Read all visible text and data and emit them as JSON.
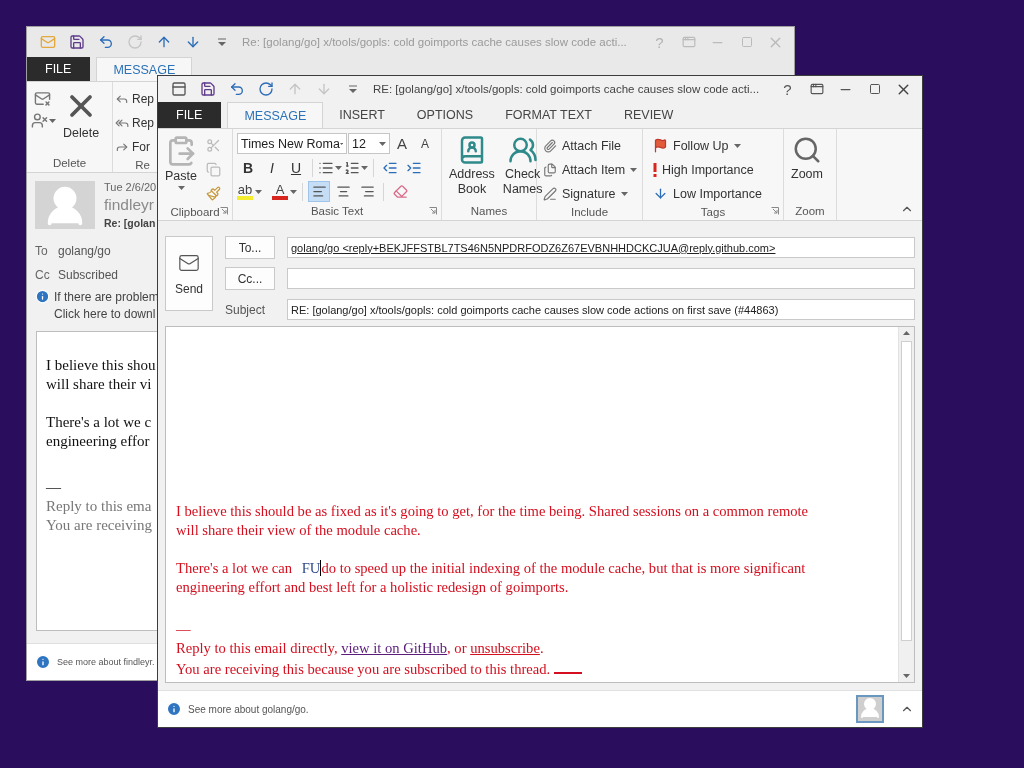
{
  "back_window": {
    "title": "Re: [golang/go] x/tools/gopls: cold goimports cache causes slow code acti...",
    "help": "?",
    "quick_access": [
      {
        "kind": "envelope",
        "disabled": false
      },
      {
        "kind": "save",
        "disabled": false
      },
      {
        "kind": "undo",
        "disabled": false
      },
      {
        "kind": "redo",
        "disabled": true
      },
      {
        "kind": "up",
        "disabled": false
      },
      {
        "kind": "down",
        "disabled": false
      }
    ],
    "tabs": [
      {
        "kind": "file",
        "label": "FILE",
        "selected": false
      },
      {
        "kind": "tab",
        "label": "MESSAGE",
        "selected": true
      }
    ],
    "delete_group": {
      "label": "Delete",
      "button": "Delete"
    },
    "respond_group": {
      "label": "Re",
      "items": [
        {
          "kind": "reply",
          "label": "Rep"
        },
        {
          "kind": "reply_all",
          "label": "Rep"
        },
        {
          "kind": "forward",
          "label": "For"
        }
      ]
    },
    "header": {
      "date": "Tue 2/6/20",
      "sender": "findleyr",
      "subject": "Re: [golan",
      "to_label": "To",
      "to": "golang/go",
      "cc_label": "Cc",
      "cc": "Subscribed",
      "info": [
        "If there are problem",
        "Click here to downl"
      ]
    },
    "body": [
      {
        "kind": "text",
        "lines": [
          "I believe this shou",
          "will share their vi"
        ]
      },
      {
        "kind": "text",
        "lines": [
          "There's a lot we c",
          "engineering effor"
        ]
      },
      {
        "kind": "separator",
        "lines": [
          "—"
        ]
      },
      {
        "kind": "note",
        "lines": [
          "Reply to this ema",
          "You are receiving"
        ]
      }
    ],
    "footer": "See more about findleyr."
  },
  "front_window": {
    "title": "RE: [golang/go] x/tools/gopls: cold goimports cache causes slow code acti...",
    "help": "?",
    "quick_access": [
      {
        "kind": "compose",
        "disabled": false
      },
      {
        "kind": "save",
        "disabled": false
      },
      {
        "kind": "undo",
        "disabled": false
      },
      {
        "kind": "redo",
        "disabled": false
      },
      {
        "kind": "up",
        "disabled": true
      },
      {
        "kind": "down",
        "disabled": true
      }
    ],
    "tabs": [
      {
        "kind": "file",
        "label": "FILE",
        "selected": false
      },
      {
        "kind": "tab",
        "label": "MESSAGE",
        "selected": true
      },
      {
        "kind": "tab",
        "label": "INSERT",
        "selected": false
      },
      {
        "kind": "tab",
        "label": "OPTIONS",
        "selected": false
      },
      {
        "kind": "tab",
        "label": "FORMAT TEXT",
        "selected": false
      },
      {
        "kind": "tab",
        "label": "REVIEW",
        "selected": false
      }
    ],
    "clipboard": {
      "label": "Clipboard",
      "paste": "Paste"
    },
    "basic_text": {
      "label": "Basic Text",
      "font": "Times New Roma",
      "size": "12",
      "grow": "A",
      "shrink": "A",
      "bold": "B",
      "italic": "I",
      "underline": "U",
      "highlight": "ab",
      "font_color": "A",
      "alignment": [
        {
          "kind": "left",
          "selected": true
        },
        {
          "kind": "center",
          "selected": false
        },
        {
          "kind": "right",
          "selected": false
        }
      ]
    },
    "names": {
      "label": "Names",
      "buttons": [
        {
          "kind": "address_book",
          "lines": [
            "Address",
            "Book"
          ]
        },
        {
          "kind": "check_names",
          "lines": [
            "Check",
            "Names"
          ]
        }
      ]
    },
    "include": {
      "label": "Include",
      "items": [
        {
          "kind": "attach_file",
          "label": "Attach File",
          "dropdown": false
        },
        {
          "kind": "attach_item",
          "label": "Attach Item",
          "dropdown": true
        },
        {
          "kind": "signature",
          "label": "Signature",
          "dropdown": true
        }
      ]
    },
    "tags": {
      "label": "Tags",
      "items": [
        {
          "kind": "flag",
          "label": "Follow Up",
          "dropdown": true
        },
        {
          "kind": "high",
          "label": "High Importance",
          "dropdown": false
        },
        {
          "kind": "low",
          "label": "Low Importance",
          "dropdown": false
        }
      ]
    },
    "zoom": {
      "label": "Zoom",
      "button": "Zoom"
    },
    "compose": {
      "send": "Send",
      "to_button": "To...",
      "to": "golang/go <reply+BEKJFFSTBL7TS46N5NPDRFODZ6Z67EVBNHHDCKCJUA@reply.github.com>",
      "cc_button": "Cc...",
      "subject_label": "Subject",
      "subject": "RE: [golang/go] x/tools/gopls: cold goimports cache causes slow code actions on first save (#44863)"
    },
    "body": [
      {
        "kind": "text",
        "segments": [
          {
            "kind": "text",
            "text": "I believe this should be as fixed as it's going to get, for the time being. Shared sessions on a common remote will share their view of the module cache."
          }
        ]
      },
      {
        "kind": "text",
        "segments": [
          {
            "kind": "text",
            "text": "There's a lot we can "
          },
          {
            "kind": "typed",
            "text": "FU"
          },
          {
            "kind": "text",
            "text": "do to speed up the initial indexing of the module cache, but that is more significant engineering effort and best left for a holistic redesign of goimports."
          }
        ]
      },
      {
        "kind": "separator",
        "segments": [
          {
            "kind": "text",
            "text": "—"
          }
        ]
      },
      {
        "kind": "text",
        "segments": [
          {
            "kind": "text",
            "text": "Reply to this email directly, "
          },
          {
            "kind": "visited_link",
            "text": "view it on GitHub"
          },
          {
            "kind": "text",
            "text": ", or "
          },
          {
            "kind": "link",
            "text": "unsubscribe"
          },
          {
            "kind": "text",
            "text": "."
          },
          {
            "kind": "break"
          },
          {
            "kind": "text",
            "text": "You are receiving this because you are subscribed to this thread."
          },
          {
            "kind": "blank_link"
          }
        ]
      }
    ],
    "footer": "See more about golang/go."
  }
}
